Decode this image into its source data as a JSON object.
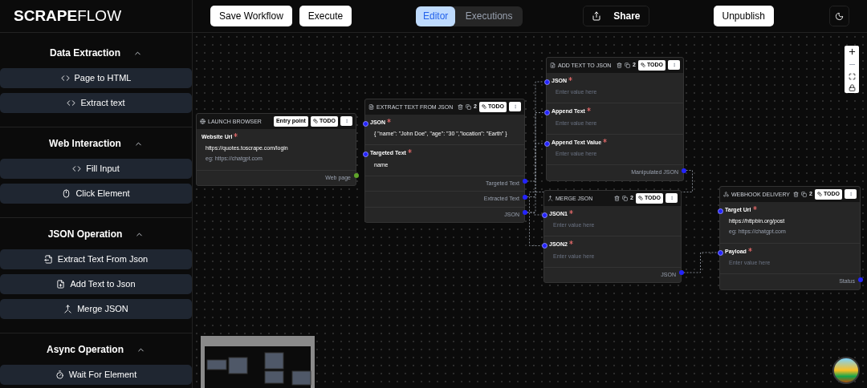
{
  "logo": {
    "bold": "SCRAPE",
    "light": "FLOW"
  },
  "toolbar": {
    "buttons": [
      "Save Workflow",
      "Execute"
    ],
    "tabs": [
      {
        "label": "Editor",
        "selected": true
      },
      {
        "label": "Executions",
        "selected": false
      }
    ],
    "share": "Share",
    "publish": "Unpublish"
  },
  "sidebar": {
    "sections": [
      {
        "title": "Data Extraction",
        "expanded": true,
        "items": [
          {
            "label": "Page to HTML",
            "kind": "code"
          },
          {
            "label": "Extract text",
            "kind": "code"
          }
        ]
      },
      {
        "title": "Web Interaction",
        "expanded": true,
        "items": [
          {
            "label": "Fill Input",
            "kind": "code"
          },
          {
            "label": "Click Element",
            "kind": "mouse"
          }
        ]
      },
      {
        "title": "JSON Operation",
        "expanded": true,
        "items": [
          {
            "label": "Extract Text From Json",
            "kind": "file-out"
          },
          {
            "label": "Add Text to Json",
            "kind": "file-plus"
          },
          {
            "label": "Merge JSON",
            "kind": "merge"
          }
        ]
      },
      {
        "title": "Async Operation",
        "expanded": true,
        "items": [
          {
            "label": "Wait For Element",
            "kind": "timer"
          }
        ]
      }
    ]
  },
  "nodes": [
    {
      "title": "LAUNCH BROWSER",
      "kind": "globe",
      "entry": "Entry point",
      "todo": "TODO",
      "fields": [
        {
          "label": "Website Url",
          "required": true,
          "handle": false,
          "value": "https://quotes.toscrape.com/login",
          "hint": "eg: https://chatgpt.com"
        }
      ],
      "outputs": [
        {
          "label": "Web page",
          "color": "#5fa52a"
        }
      ]
    },
    {
      "title": "EXTRACT TEXT FROM JSON",
      "kind": "file",
      "copies": "2",
      "todo": "TODO",
      "fields": [
        {
          "label": "JSON",
          "required": true,
          "handle": true,
          "value": "{  \"name\": \"John Doe\",   \"age\": \"30 \",\"location\": \"Earth\" }"
        },
        {
          "label": "Targeted Text",
          "required": true,
          "handle": true,
          "value": "name"
        }
      ],
      "outputs": [
        {
          "label": "Targeted Text",
          "color": "#2424ff"
        },
        {
          "label": "Extracted Text",
          "color": "#2424ff"
        },
        {
          "label": "JSON",
          "color": "#2424ff"
        }
      ]
    },
    {
      "title": "ADD TEXT TO JSON",
      "kind": "file-plus",
      "copies": "2",
      "todo": "TODO",
      "fields": [
        {
          "label": "JSON",
          "required": true,
          "handle": true,
          "placeholder": "Enter value here"
        },
        {
          "label": "Append Text",
          "required": true,
          "handle": true,
          "placeholder": "Enter value here"
        },
        {
          "label": "Append Text Value",
          "required": true,
          "handle": true,
          "placeholder": "Enter value here"
        }
      ],
      "outputs": [
        {
          "label": "Manipulated JSON",
          "color": "#2424ff"
        }
      ]
    },
    {
      "title": "MERGE JSON",
      "kind": "merge",
      "copies": "2",
      "todo": "TODO",
      "fields": [
        {
          "label": "JSON1",
          "required": true,
          "handle": true,
          "placeholder": "Enter value here"
        },
        {
          "label": "JSON2",
          "required": true,
          "handle": true,
          "placeholder": "Enter value here"
        }
      ],
      "outputs": [
        {
          "label": "JSON",
          "color": "#2424ff"
        }
      ]
    },
    {
      "title": "WEBHOOK DELIVERY",
      "kind": "webhook",
      "copies": "2",
      "todo": "TODO",
      "fields": [
        {
          "label": "Target Url",
          "required": true,
          "handle": true,
          "value": "https://httpbin.org/post",
          "hint": "eg: https://chatgpt.com"
        },
        {
          "label": "Payload",
          "required": true,
          "handle": true,
          "placeholder": "Enter value here"
        }
      ],
      "outputs": [
        {
          "label": "Status",
          "color": "#2424ff"
        }
      ]
    }
  ]
}
